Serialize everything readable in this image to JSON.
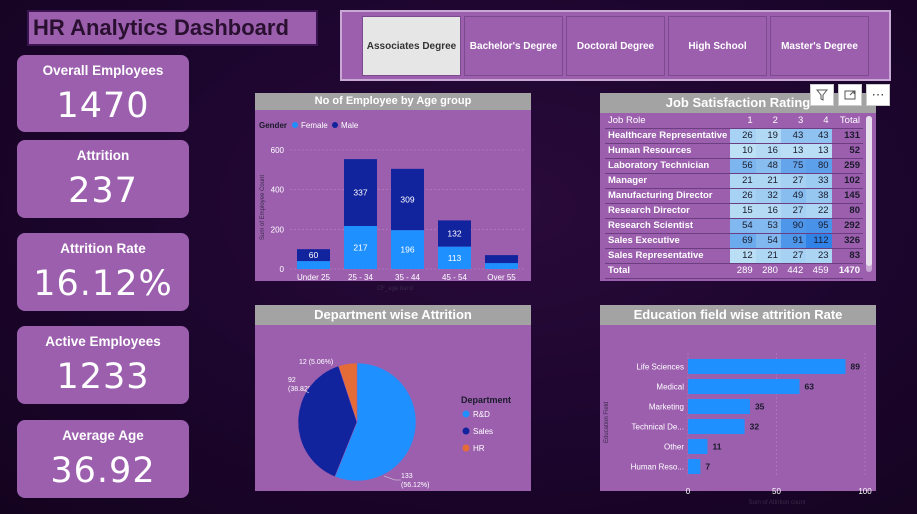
{
  "title": "HR Analytics Dashboard",
  "kpis": [
    {
      "label": "Overall Employees",
      "value": "1470"
    },
    {
      "label": "Attrition",
      "value": "237"
    },
    {
      "label": "Attrition Rate",
      "value": "16.12%"
    },
    {
      "label": "Active Employees",
      "value": "1233"
    },
    {
      "label": "Average Age",
      "value": "36.92"
    }
  ],
  "slicer": {
    "options": [
      "Associates Degree",
      "Bachelor's Degree",
      "Doctoral Degree",
      "High School",
      "Master's Degree"
    ],
    "selected": "Associates Degree"
  },
  "age_chart": {
    "title": "No of Employee by Age group",
    "legend_title": "Gender",
    "ylabel": "Sum of Employee Count",
    "xlabel": "CF_age band",
    "colors": {
      "Female": "#1e90ff",
      "Male": "#12239e"
    }
  },
  "dept_chart": {
    "title": "Department wise Attrition",
    "legend_title": "Department",
    "slice_labels": [
      {
        "count": "133",
        "pct": "(56.12%)"
      },
      {
        "count": "92",
        "pct": "(38.82%)"
      },
      {
        "count": "12 (5.06%)",
        "pct": ""
      }
    ],
    "colors": {
      "R&D": "#1e90ff",
      "Sales": "#12239e",
      "HR": "#e66c37"
    }
  },
  "edu_chart": {
    "title": "Education field wise attrition Rate",
    "ylabel": "Education Field",
    "xlabel": "Sum of Attrition count",
    "category_labels": [
      "Life Sciences",
      "Medical",
      "Marketing",
      "Technical De...",
      "Other",
      "Human Reso..."
    ]
  },
  "job_table": {
    "title": "Job Satisfaction Rating",
    "headers": [
      "Job Role",
      "1",
      "2",
      "3",
      "4",
      "Total"
    ],
    "rows": [
      {
        "role": "Healthcare Representative",
        "v": [
          26,
          19,
          43,
          43
        ],
        "total": 131
      },
      {
        "role": "Human Resources",
        "v": [
          10,
          16,
          13,
          13
        ],
        "total": 52
      },
      {
        "role": "Laboratory Technician",
        "v": [
          56,
          48,
          75,
          80
        ],
        "total": 259
      },
      {
        "role": "Manager",
        "v": [
          21,
          21,
          27,
          33
        ],
        "total": 102
      },
      {
        "role": "Manufacturing Director",
        "v": [
          26,
          32,
          49,
          38
        ],
        "total": 145
      },
      {
        "role": "Research Director",
        "v": [
          15,
          16,
          27,
          22
        ],
        "total": 80
      },
      {
        "role": "Research Scientist",
        "v": [
          54,
          53,
          90,
          95
        ],
        "total": 292
      },
      {
        "role": "Sales Executive",
        "v": [
          69,
          54,
          91,
          112
        ],
        "total": 326
      },
      {
        "role": "Sales Representative",
        "v": [
          12,
          21,
          27,
          23
        ],
        "total": 83
      }
    ],
    "total_label": "Total",
    "totals": [
      289,
      280,
      442,
      459,
      1470
    ]
  },
  "toolbar": {
    "filter_icon": "filter-icon",
    "focus_icon": "focus-mode-icon",
    "more_icon": "more-options-icon",
    "more_label": "⋯"
  },
  "chart_data": [
    {
      "type": "bar",
      "stacked": true,
      "title": "No of Employee by Age group",
      "xlabel": "CF_age band",
      "ylabel": "Sum of Employee Count",
      "categories": [
        "Under 25",
        "25 - 34",
        "35 - 44",
        "45 - 54",
        "Over 55"
      ],
      "series": [
        {
          "name": "Female",
          "values": [
            40,
            217,
            196,
            113,
            30
          ]
        },
        {
          "name": "Male",
          "values": [
            60,
            337,
            309,
            132,
            40
          ]
        }
      ],
      "data_labels": {
        "Female": [
          "",
          "217",
          "196",
          "113",
          ""
        ],
        "Male": [
          "60",
          "337",
          "309",
          "132",
          ""
        ]
      },
      "ylim": [
        0,
        600
      ],
      "yticks": [
        0,
        200,
        400,
        600
      ],
      "legend": "top-left"
    },
    {
      "type": "pie",
      "donut": false,
      "title": "Department wise Attrition",
      "categories": [
        "R&D",
        "Sales",
        "HR"
      ],
      "values": [
        133,
        92,
        12
      ],
      "percents": [
        56.12,
        38.82,
        5.06
      ],
      "legend": "right"
    },
    {
      "type": "bar",
      "orientation": "horizontal",
      "title": "Education field wise attrition Rate",
      "categories": [
        "Life Sciences",
        "Medical",
        "Marketing",
        "Technical De...",
        "Other",
        "Human Reso..."
      ],
      "values": [
        89,
        63,
        35,
        32,
        11,
        7
      ],
      "xlabel": "Sum of Attrition count",
      "ylabel": "Education Field",
      "xlim": [
        0,
        100
      ],
      "xticks": [
        0,
        50,
        100
      ]
    }
  ]
}
